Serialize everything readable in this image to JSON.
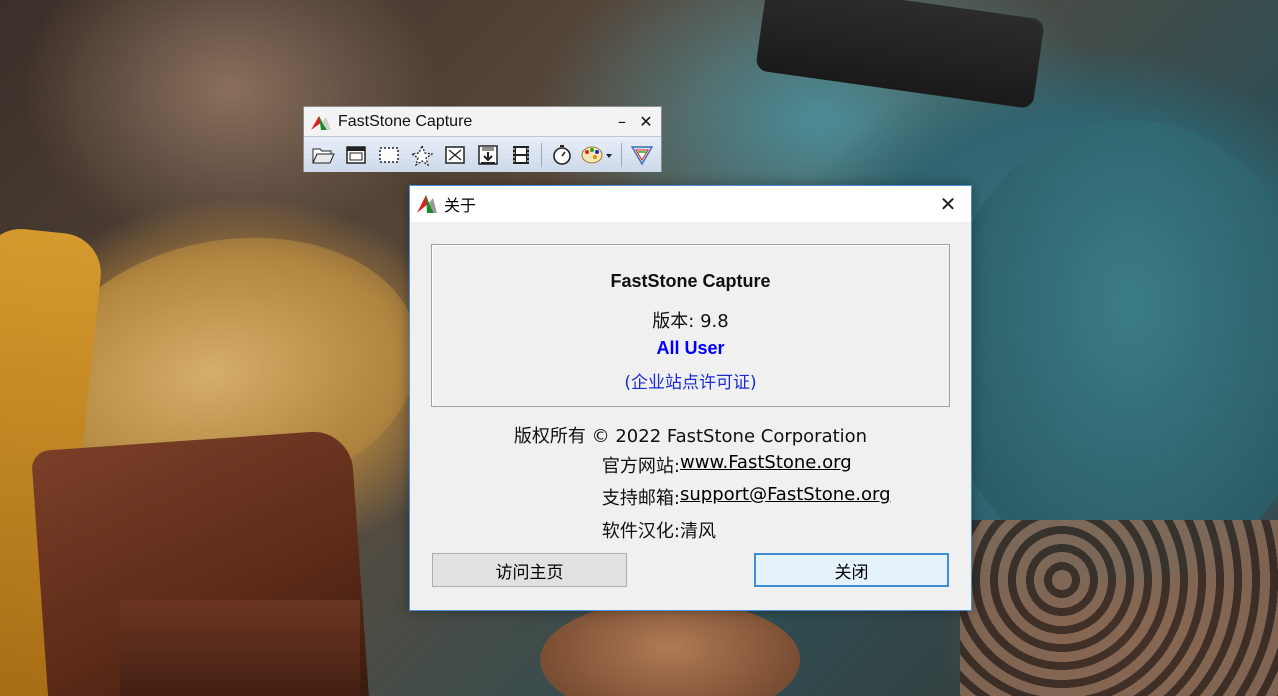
{
  "toolbar_window": {
    "title": "FastStone Capture",
    "minimize_glyph": "–",
    "close_glyph": "✕",
    "tools": [
      {
        "name": "open-icon"
      },
      {
        "name": "capture-active-window-icon"
      },
      {
        "name": "capture-rectangle-icon"
      },
      {
        "name": "capture-freehand-icon"
      },
      {
        "name": "capture-fullscreen-icon"
      },
      {
        "name": "capture-scrolling-icon"
      },
      {
        "name": "screen-recorder-icon"
      },
      {
        "name": "delay-timer-icon"
      },
      {
        "name": "output-palette-icon"
      },
      {
        "name": "settings-icon"
      }
    ]
  },
  "about_dialog": {
    "title": "关于",
    "close_glyph": "✕",
    "product_name": "FastStone Capture",
    "version_text": "版本: 9.8",
    "license_user": "All User",
    "license_type": "(企业站点许可证)",
    "copyright": "版权所有 © 2022 FastStone Corporation",
    "website_label": "官方网站:",
    "website_value": "www.FastStone.org",
    "email_label": "支持邮箱:",
    "email_value": "support@FastStone.org",
    "translation_label": "软件汉化:",
    "translation_value": "清风",
    "visit_home_button": "访问主页",
    "close_button": "关闭"
  },
  "colors": {
    "dialog_border": "#4a90d9",
    "license_user": "#0000ff",
    "license_type": "#1a2bd6",
    "default_button_border": "#3c8fd7"
  }
}
